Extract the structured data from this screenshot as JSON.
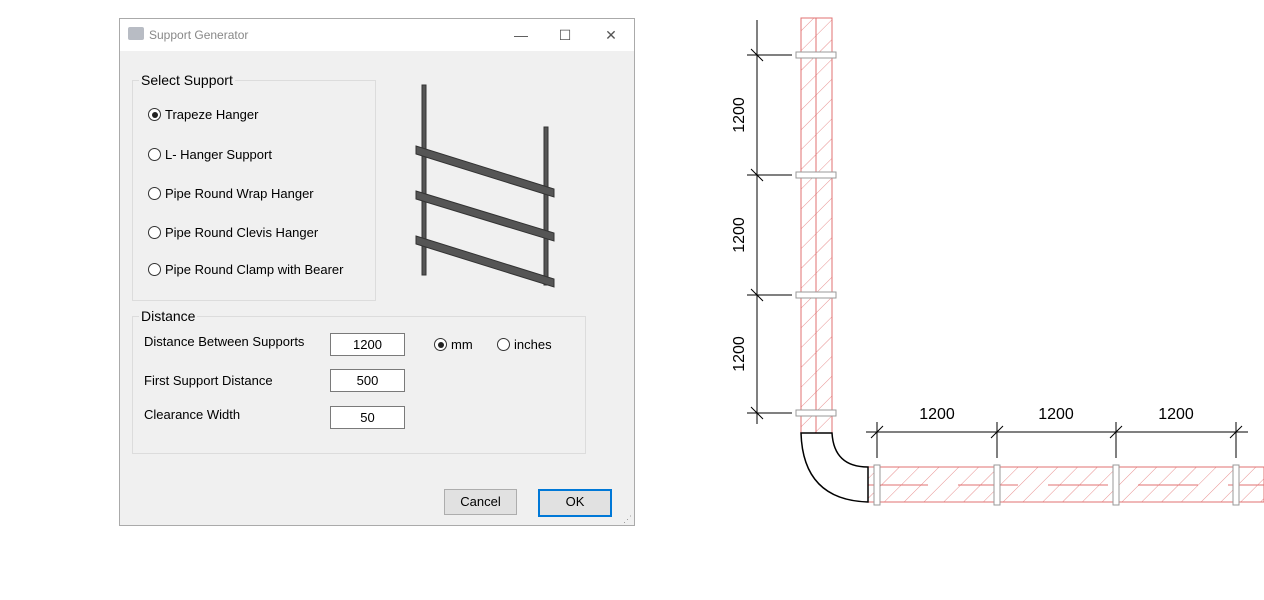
{
  "dialog": {
    "title": "Support Generator",
    "minimize": "—",
    "maximize": "☐",
    "close": "✕"
  },
  "select_support": {
    "legend": "Select Support",
    "options": [
      "Trapeze Hanger",
      "L- Hanger Support",
      "Pipe Round Wrap Hanger",
      "Pipe Round Clevis Hanger",
      "Pipe Round Clamp with Bearer"
    ],
    "selected": "Trapeze Hanger"
  },
  "distance": {
    "legend": "Distance",
    "between_label": "Distance Between Supports",
    "between_value": "1200",
    "first_label": "First Support Distance",
    "first_value": "500",
    "clearance_label": "Clearance Width",
    "clearance_value": "50",
    "unit_mm": "mm",
    "unit_inches": "inches",
    "unit_selected": "mm"
  },
  "buttons": {
    "cancel": "Cancel",
    "ok": "OK"
  },
  "drawing": {
    "vertical_dims": [
      "1200",
      "1200",
      "1200"
    ],
    "horizontal_dims": [
      "1200",
      "1200",
      "1200"
    ]
  }
}
